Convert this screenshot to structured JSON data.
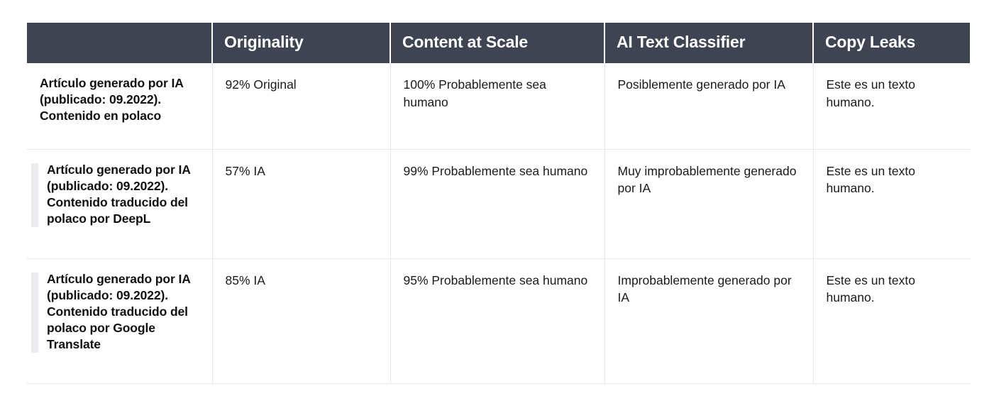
{
  "table": {
    "columns": [
      {
        "key": "label",
        "header": ""
      },
      {
        "key": "originality",
        "header": "Originality"
      },
      {
        "key": "content_at_scale",
        "header": "Content at Scale"
      },
      {
        "key": "ai_text_classifier",
        "header": "AI Text Classifier"
      },
      {
        "key": "copy_leaks",
        "header": "Copy Leaks"
      }
    ],
    "rows": [
      {
        "label": "Artículo generado por IA (publicado: 09.2022). Contenido en polaco",
        "has_accent_bar": false,
        "originality": "92% Original",
        "content_at_scale": "100% Probablemente sea humano",
        "ai_text_classifier": "Posiblemente generado por IA",
        "copy_leaks": "Este es un texto humano."
      },
      {
        "label": "Artículo generado por IA (publicado: 09.2022). Contenido traducido del polaco por DeepL",
        "has_accent_bar": true,
        "originality": "57% IA",
        "content_at_scale": "99% Probablemente sea humano",
        "ai_text_classifier": "Muy improbablemente generado por IA",
        "copy_leaks": "Este es un texto humano."
      },
      {
        "label": "Artículo generado por IA (publicado: 09.2022). Contenido traducido del polaco por Google Translate",
        "has_accent_bar": true,
        "originality": "85% IA",
        "content_at_scale": "95% Probablemente sea humano",
        "ai_text_classifier": "Improbablemente generado por IA",
        "copy_leaks": "Este es un texto humano."
      }
    ]
  },
  "colors": {
    "header_background": "#3e4452",
    "header_text": "#ffffff",
    "body_text": "#1a1a1a",
    "label_text": "#111111",
    "grid_line": "#e6e8ea",
    "accent_bar": "#e9ebee",
    "page_background": "#ffffff"
  }
}
